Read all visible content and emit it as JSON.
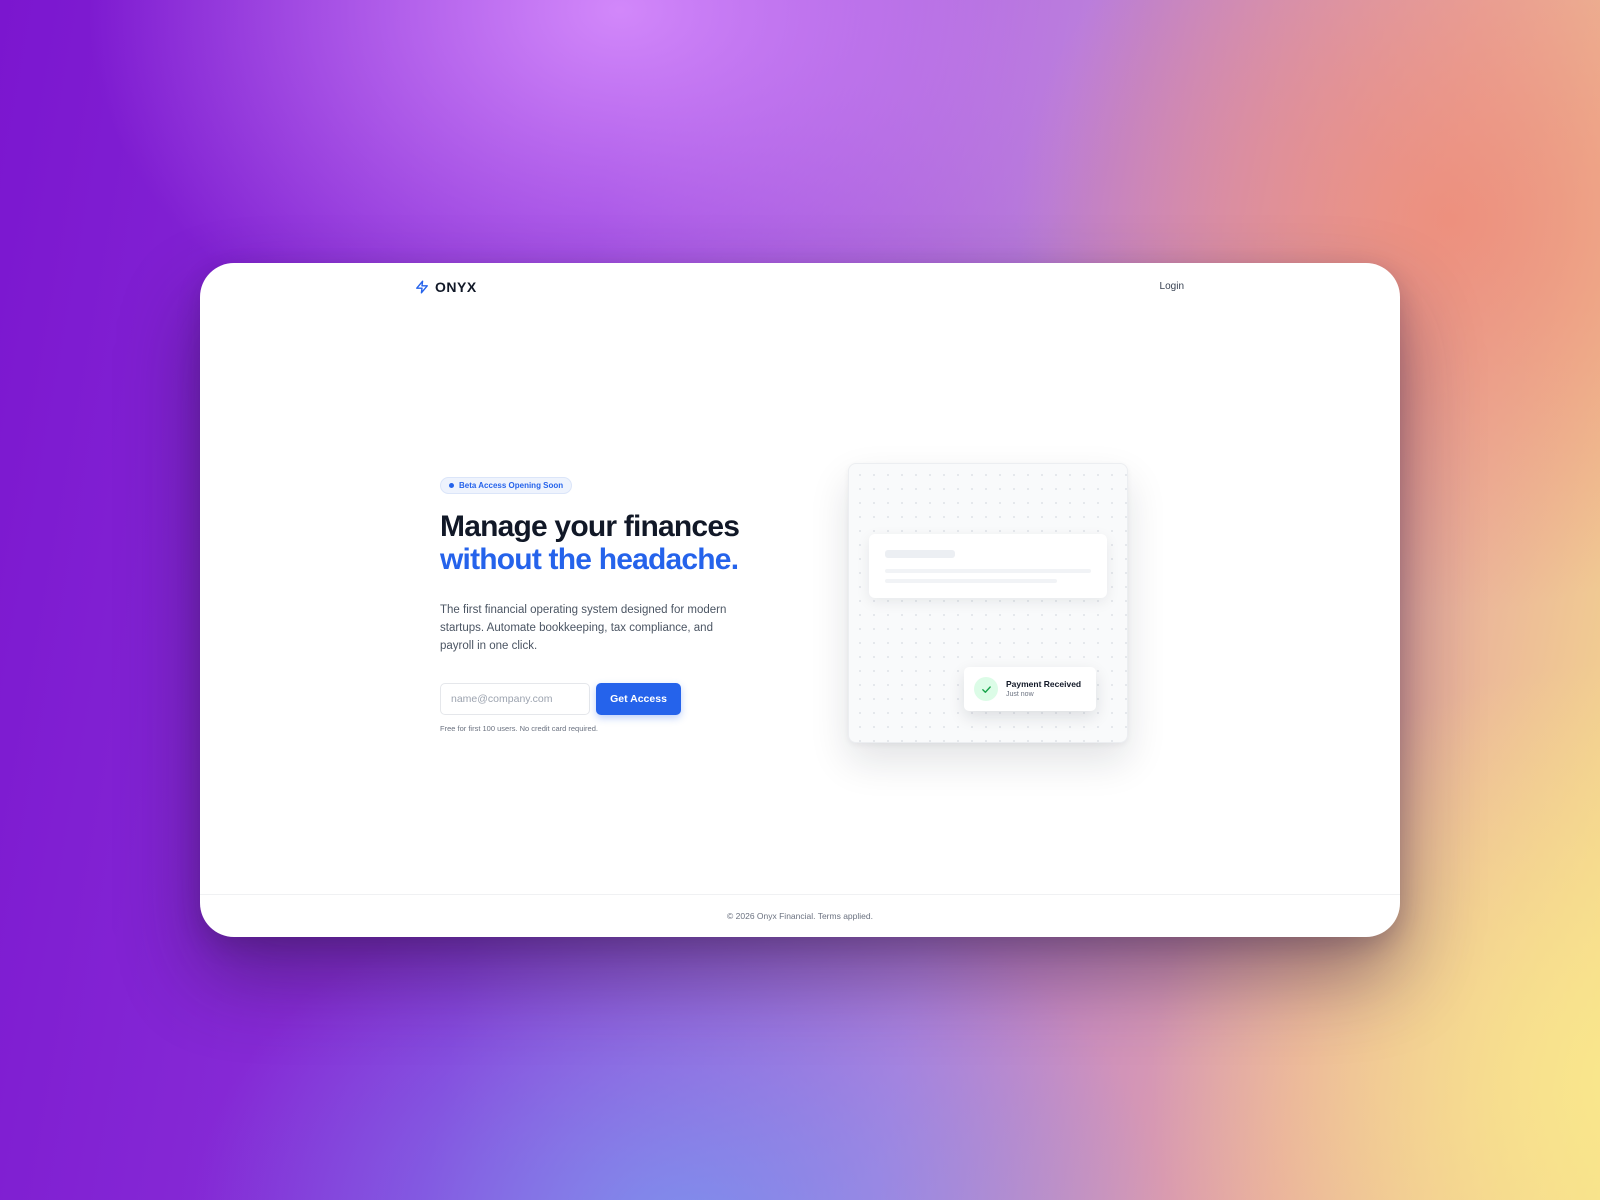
{
  "brand": {
    "name": "ONYX",
    "icon": "lightning-bolt-icon",
    "accent_color": "#2563eb"
  },
  "nav": {
    "login_label": "Login"
  },
  "hero": {
    "badge": "Beta Access Opening Soon",
    "headline_line1": "Manage your finances",
    "headline_line2": "without the headache.",
    "description": "The first financial operating system designed for modern startups. Automate bookkeeping, tax compliance, and payroll in one click.",
    "email_placeholder": "name@company.com",
    "email_value": "",
    "cta_label": "Get Access",
    "fineprint": "Free for first 100 users. No credit card required."
  },
  "illustration": {
    "notification_title": "Payment Received",
    "notification_time": "Just now",
    "notification_icon": "check-icon",
    "success_color": "#16a34a"
  },
  "footer": {
    "text": "© 2026 Onyx Financial. Terms applied."
  }
}
